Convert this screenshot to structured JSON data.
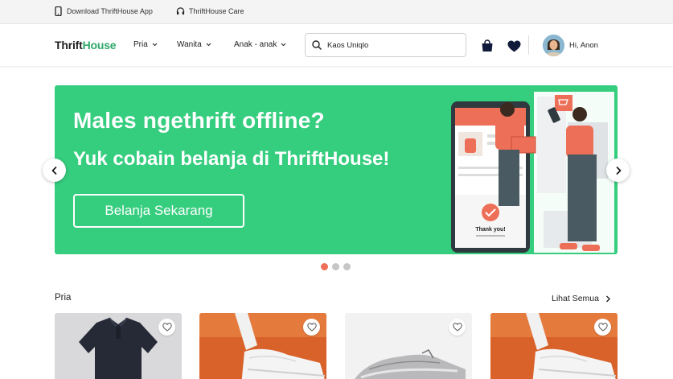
{
  "topbar": {
    "download_app": "Download ThriftHouse App",
    "care": "ThriftHouse Care"
  },
  "navbar": {
    "logo_part1": "Thrift",
    "logo_part2": "House",
    "menus": [
      "Pria",
      "Wanita",
      "Anak - anak"
    ],
    "search_value": "Kaos Uniqlo",
    "greeting": "Hi, Anon"
  },
  "banner": {
    "headline": "Males ngethrift offline?",
    "subheadline": "Yuk cobain belanja di ThriftHouse!",
    "cta": "Belanja Sekarang",
    "illustration_text": "Thank you!",
    "slide_count": 3,
    "active_slide": 1
  },
  "section": {
    "title": "Pria",
    "see_all": "Lihat Semua"
  },
  "products": [
    {
      "image": "polo-shirt-navy"
    },
    {
      "image": "sneaker-orange-bg"
    },
    {
      "image": "sneaker-grey"
    },
    {
      "image": "sneaker-orange-bg"
    }
  ],
  "colors": {
    "brand_green": "#35cd7e",
    "logo_green": "#2fa86a",
    "accent_orange": "#ee6f57"
  },
  "icons": [
    "phone-icon",
    "headset-icon",
    "search-icon",
    "shopping-bag-icon",
    "heart-icon",
    "chevron-left-icon",
    "chevron-right-icon",
    "chevron-down-icon",
    "heart-outline-icon"
  ]
}
